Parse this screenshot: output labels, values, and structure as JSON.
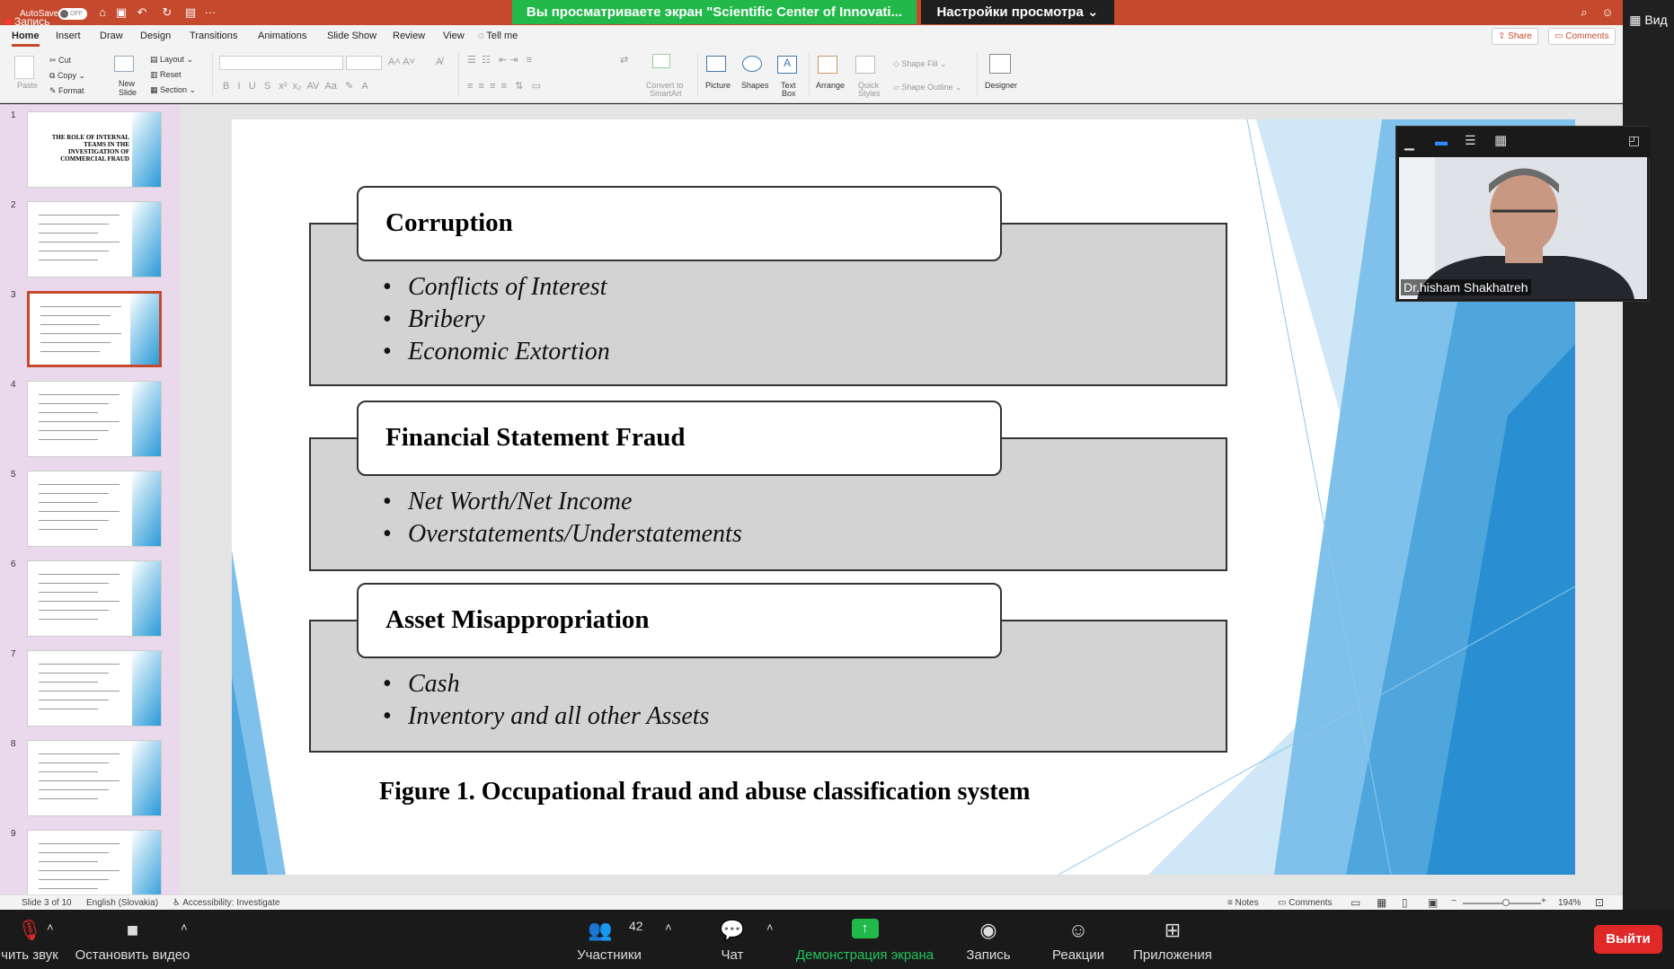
{
  "titlebar": {
    "autosave": "AutoSave",
    "autosave_state": "OFF",
    "recording": "Запись",
    "more": "···"
  },
  "zoom_banner": {
    "sharing_text": "Вы просматриваете экран \"Scientific Center of Innovati...",
    "view_options": "Настройки просмотра",
    "view_button": "Вид"
  },
  "ribbon_tabs": [
    "Home",
    "Insert",
    "Draw",
    "Design",
    "Transitions",
    "Animations",
    "Slide Show",
    "Review",
    "View",
    "Tell me"
  ],
  "ribbon_right": {
    "share": "Share",
    "comments": "Comments"
  },
  "ribbon": {
    "paste": "Paste",
    "cut": "Cut",
    "copy": "Copy",
    "format": "Format",
    "new_slide_1": "New",
    "new_slide_2": "Slide",
    "layout": "Layout",
    "reset": "Reset",
    "section": "Section",
    "convert_1": "Convert to",
    "convert_2": "SmartArt",
    "picture": "Picture",
    "shapes": "Shapes",
    "textbox_1": "Text",
    "textbox_2": "Box",
    "arrange": "Arrange",
    "quick_1": "Quick",
    "quick_2": "Styles",
    "shape_fill": "Shape Fill",
    "shape_outline": "Shape Outline",
    "designer": "Designer"
  },
  "thumbnails": [
    {
      "num": "1",
      "text": "THE ROLE OF INTERNAL TEAMS IN THE INVESTIGATION OF COMMERCIAL FRAUD"
    },
    {
      "num": "2"
    },
    {
      "num": "3",
      "selected": true
    },
    {
      "num": "4"
    },
    {
      "num": "5"
    },
    {
      "num": "6"
    },
    {
      "num": "7"
    },
    {
      "num": "8"
    },
    {
      "num": "9"
    }
  ],
  "slide": {
    "sections": [
      {
        "title": "Corruption",
        "items": [
          "Conflicts of Interest",
          "Bribery",
          "Economic Extortion"
        ]
      },
      {
        "title": "Financial Statement Fraud",
        "items": [
          "Net Worth/Net Income",
          "Overstatements/Understatements"
        ]
      },
      {
        "title": "Asset Misappropriation",
        "items": [
          "Cash",
          "Inventory and all other Assets"
        ]
      }
    ],
    "caption": "Figure 1. Occupational fraud and abuse classification system"
  },
  "video_tile": {
    "participant_name": "Dr.hisham Shakhatreh"
  },
  "statusbar": {
    "slide_info": "Slide 3 of 10",
    "language": "English (Slovakia)",
    "accessibility": "Accessibility: Investigate",
    "notes": "Notes",
    "comments": "Comments",
    "zoom": "194%",
    "zoom_level": 0.55
  },
  "zoom_controls": {
    "mute": "чить звук",
    "stop_video": "Остановить видео",
    "participants": "Участники",
    "participants_count": "42",
    "chat": "Чат",
    "share_screen": "Демонстрация экрана",
    "record": "Запись",
    "reactions": "Реакции",
    "apps": "Приложения",
    "leave": "Выйти"
  },
  "colors": {
    "accent": "#c5492d",
    "zoom_green": "#22b84a",
    "leave_red": "#e02828"
  }
}
